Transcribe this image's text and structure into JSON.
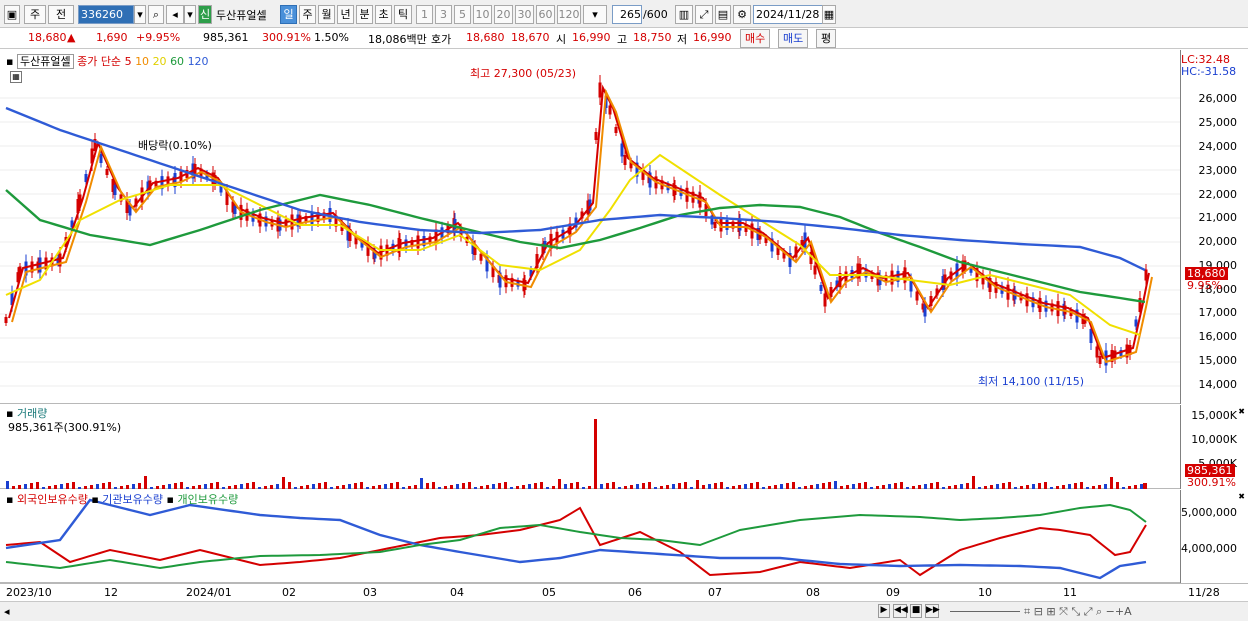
{
  "toolbar": {
    "period_type": "주",
    "prev_label": "전",
    "code": "336260",
    "credit_badge": "신",
    "stock_name": "두산퓨얼셀",
    "periods": [
      "일",
      "주",
      "월",
      "년",
      "분",
      "초",
      "틱"
    ],
    "active_period": "일",
    "intervals": [
      "1",
      "3",
      "5",
      "10",
      "20",
      "30",
      "60",
      "120"
    ],
    "count": "265",
    "count_max": "/600",
    "date": "2024/11/28"
  },
  "quote": {
    "price": "18,680",
    "change": "1,690",
    "change_pct": "+9.95%",
    "volume": "985,361",
    "volume_ratio": "300.91%",
    "turnover_pct": "1.50%",
    "amount": "18,086백만",
    "hoga_label": "호가",
    "ask": "18,680",
    "bid": "18,670",
    "open_label": "시",
    "open": "16,990",
    "high_label": "고",
    "high": "18,750",
    "low_label": "저",
    "low": "16,990",
    "buy_button": "매수",
    "sell_button": "매도",
    "eval_button": "평"
  },
  "price_pane": {
    "title": "두산퓨얼셀",
    "legend_prefix": "종가 단순",
    "ma_periods": [
      "5",
      "10",
      "20",
      "60",
      "120"
    ],
    "ma_colors": [
      "#d40000",
      "#f08c00",
      "#f0e000",
      "#1e9a3c",
      "#2f5bd6"
    ],
    "lc": "LC:32.48",
    "hc": "HC:-31.58",
    "annotation_high": "최고 27,300 (05/23)",
    "annotation_low": "최저 14,100 (11/15)",
    "annotation_div": "배당락(0.10%)",
    "price_tag": "18,680",
    "pct_tag": "9.95%",
    "yaxis": [
      "26,000",
      "25,000",
      "24,000",
      "23,000",
      "22,000",
      "21,000",
      "20,000",
      "19,000",
      "18,000",
      "17,000",
      "16,000",
      "15,000",
      "14,000"
    ]
  },
  "volume_pane": {
    "title": "거래량",
    "value": "985,361주(300.91%)",
    "yaxis": [
      "15,000K",
      "10,000K",
      "5,000K"
    ],
    "vol_tag": "985,361",
    "vol_pct_tag": "300.91%"
  },
  "holdings_pane": {
    "legend": [
      "외국인보유수량",
      "기관보유수량",
      "개인보유수량"
    ],
    "colors": [
      "#d40000",
      "#2f5bd6",
      "#1e9a3c"
    ],
    "yaxis": [
      "5,000,000",
      "4,000,000"
    ]
  },
  "xaxis": [
    "2023/10",
    "12",
    "2024/01",
    "02",
    "03",
    "04",
    "05",
    "06",
    "07",
    "08",
    "09",
    "10",
    "11",
    "11/28"
  ]
}
